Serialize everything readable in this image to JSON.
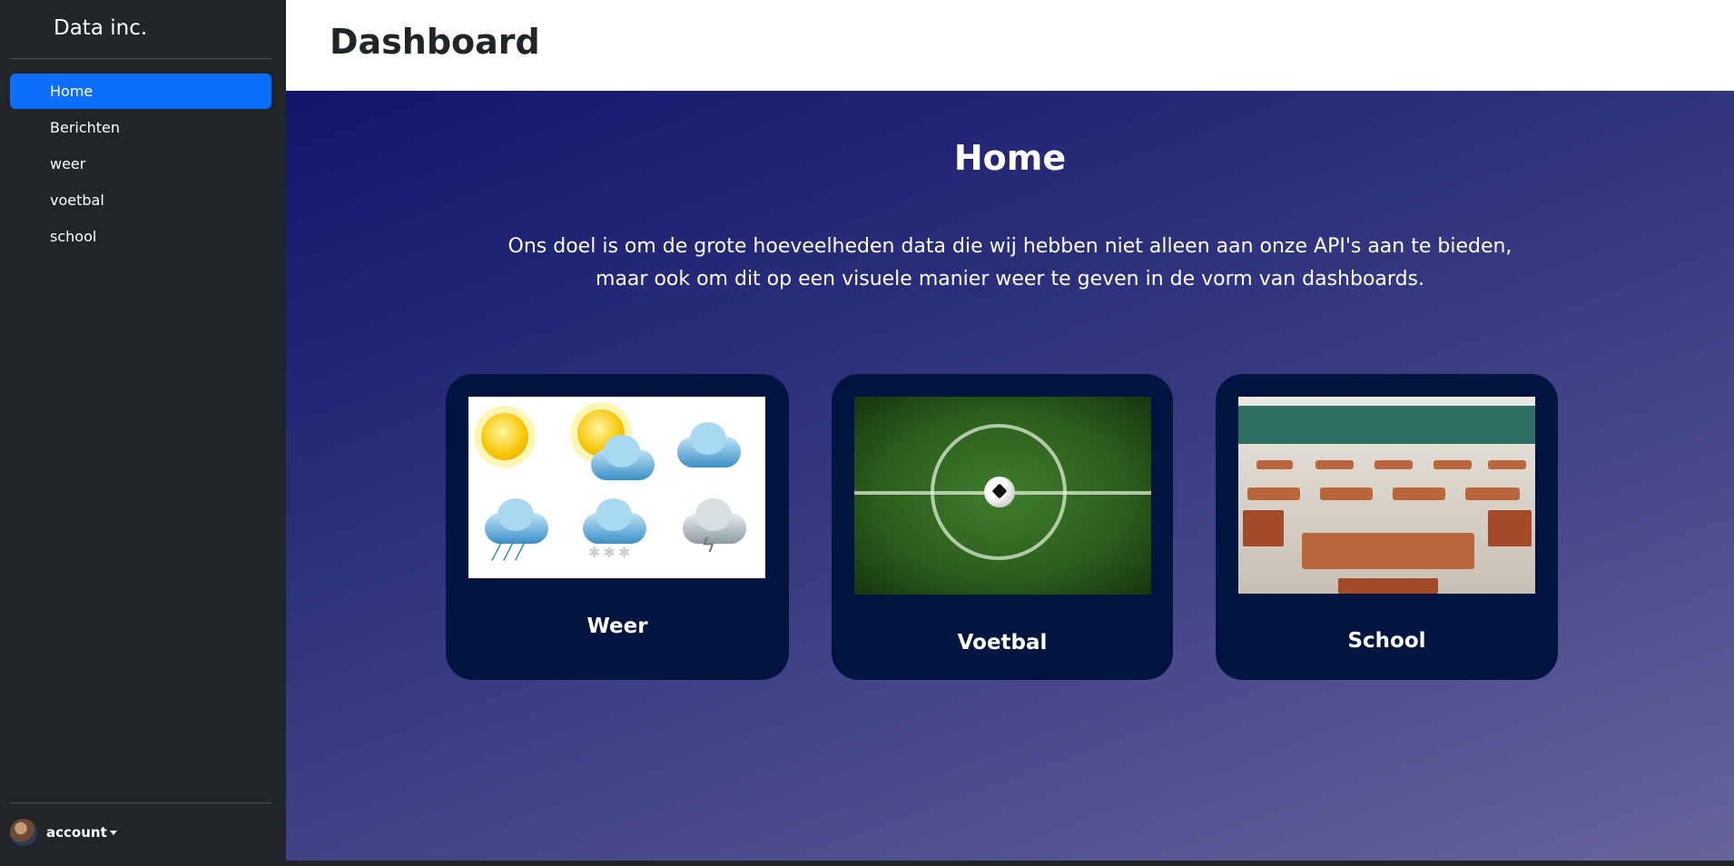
{
  "sidebar": {
    "brand": "Data inc.",
    "items": [
      {
        "label": "Home",
        "active": true
      },
      {
        "label": "Berichten",
        "active": false
      },
      {
        "label": "weer",
        "active": false
      },
      {
        "label": "voetbal",
        "active": false
      },
      {
        "label": "school",
        "active": false
      }
    ],
    "account_label": "account"
  },
  "header": {
    "title": "Dashboard"
  },
  "main": {
    "title": "Home",
    "intro_line1": "Ons doel is om de grote hoeveelheden data die wij hebben niet alleen aan onze API's aan te bieden,",
    "intro_line2": "maar ook om dit op een visuele manier weer te geven in de vorm van dashboards.",
    "cards": [
      {
        "label": "Weer",
        "icon": "weather-icons-image"
      },
      {
        "label": "Voetbal",
        "icon": "football-pitch-image"
      },
      {
        "label": "School",
        "icon": "classroom-image"
      }
    ]
  },
  "colors": {
    "sidebar_bg": "#212529",
    "accent": "#0d6efd",
    "card_bg": "#001440",
    "main_gradient_start": "#12166b",
    "main_gradient_end": "#67649c"
  }
}
